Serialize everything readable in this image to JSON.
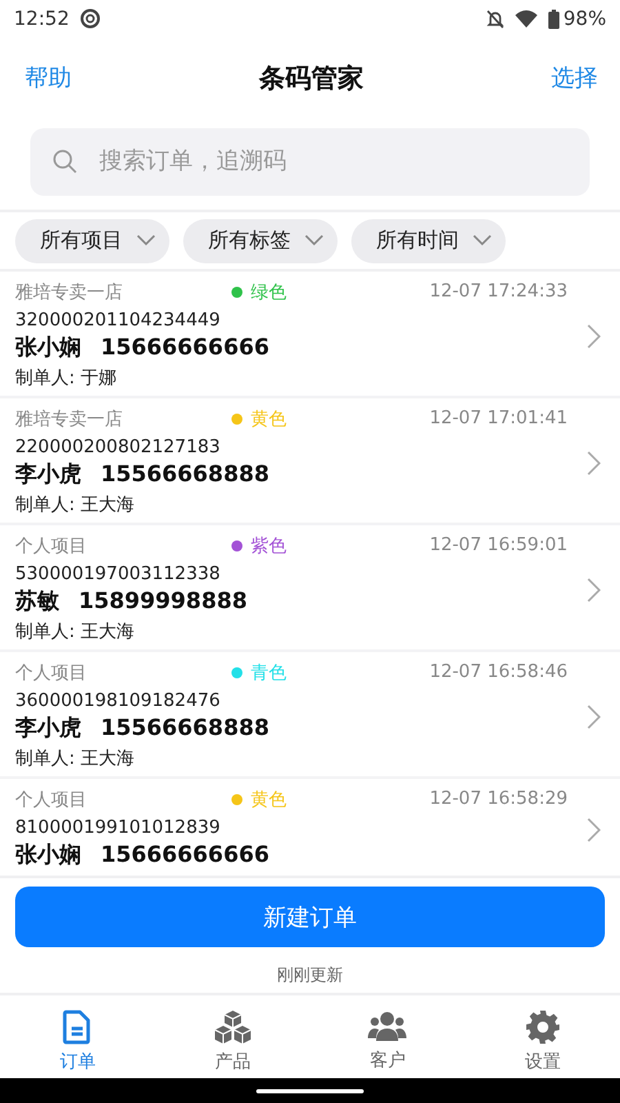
{
  "status_bar": {
    "time": "12:52",
    "battery": "98%"
  },
  "header": {
    "left": "帮助",
    "title": "条码管家",
    "right": "选择"
  },
  "search": {
    "placeholder": "搜索订单，追溯码"
  },
  "filters": [
    {
      "label": "所有项目"
    },
    {
      "label": "所有标签"
    },
    {
      "label": "所有时间"
    }
  ],
  "orders": [
    {
      "store": "雅培专卖一店",
      "tag": "绿色",
      "color": "#2fc24a",
      "time": "12-07 17:24:33",
      "code": "320000201104234449",
      "customer": "张小娴",
      "phone": "15666666666",
      "maker": "制单人: 于娜"
    },
    {
      "store": "雅培专卖一店",
      "tag": "黄色",
      "color": "#f5c518",
      "time": "12-07 17:01:41",
      "code": "220000200802127183",
      "customer": "李小虎",
      "phone": "15566668888",
      "maker": "制单人: 王大海"
    },
    {
      "store": "个人项目",
      "tag": "紫色",
      "color": "#a352d6",
      "time": "12-07 16:59:01",
      "code": "530000197003112338",
      "customer": "苏敏",
      "phone": "15899998888",
      "maker": "制单人: 王大海"
    },
    {
      "store": "个人项目",
      "tag": "青色",
      "color": "#22e0e8",
      "time": "12-07 16:58:46",
      "code": "360000198109182476",
      "customer": "李小虎",
      "phone": "15566668888",
      "maker": "制单人: 王大海"
    },
    {
      "store": "个人项目",
      "tag": "黄色",
      "color": "#f5c518",
      "time": "12-07 16:58:29",
      "code": "810000199101012839",
      "customer": "张小娴",
      "phone": "15666666666"
    }
  ],
  "new_button": "新建订单",
  "update_note": "刚刚更新",
  "tabs": [
    {
      "label": "订单",
      "kind": "document",
      "selected": true
    },
    {
      "label": "产品",
      "kind": "cubes",
      "selected": false
    },
    {
      "label": "客户",
      "kind": "people",
      "selected": false
    },
    {
      "label": "设置",
      "kind": "gear",
      "selected": false
    }
  ]
}
